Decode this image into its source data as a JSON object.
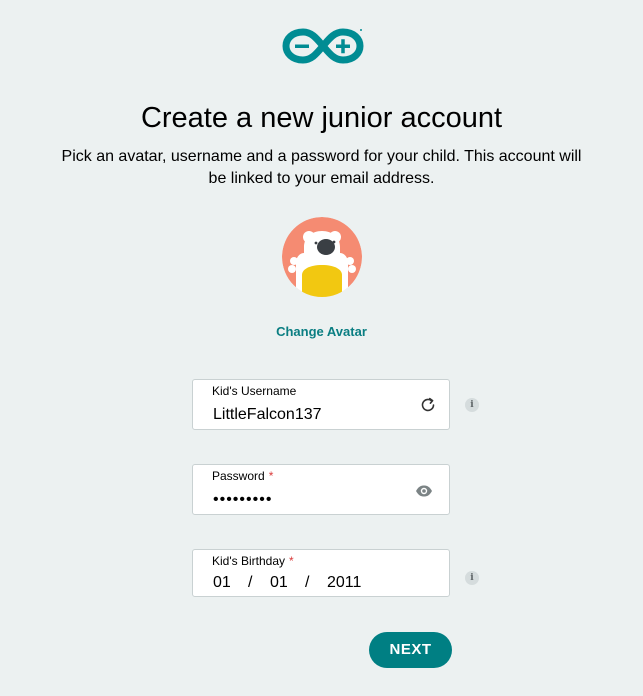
{
  "header": {
    "logo_icon": "arduino-infinity-logo-icon",
    "title": "Create a new junior account",
    "subtitle": "Pick an avatar, username and a password for your child. This account will be linked to your email address."
  },
  "avatar": {
    "icon": "polar-bear-avatar",
    "change_label": "Change Avatar"
  },
  "form": {
    "username": {
      "label": "Kid's Username",
      "value": "LittleFalcon137",
      "icon": "refresh-icon"
    },
    "password": {
      "label": "Password",
      "required_mark": "*",
      "value": "•••••••••",
      "icon": "eye-icon"
    },
    "birthday": {
      "label": "Kid's Birthday",
      "required_mark": "*",
      "day": "01",
      "month": "01",
      "year": "2011",
      "separator": "/"
    },
    "info_glyph": "i"
  },
  "actions": {
    "next_label": "NEXT"
  },
  "colors": {
    "accent": "#007f83",
    "background": "#ecf1f1",
    "required": "#da3b3b",
    "avatar_bg": "#f58b72",
    "avatar_shirt": "#f2c811"
  }
}
